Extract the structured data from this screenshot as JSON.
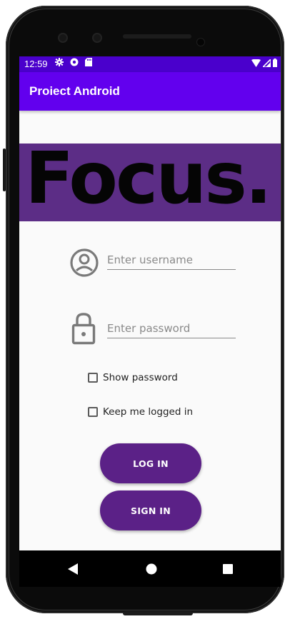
{
  "status_bar": {
    "time": "12:59",
    "left_icons": [
      "gear-icon",
      "data-saver-icon",
      "sd-card-icon"
    ],
    "right_icons": [
      "wifi-icon",
      "signal-icon",
      "battery-icon"
    ],
    "color": "#4a00cc"
  },
  "app_bar": {
    "title": "Proiect Android",
    "color": "#6200ee"
  },
  "banner": {
    "text": "Focus.",
    "background": "#5c2d86"
  },
  "form": {
    "username": {
      "icon": "account-circle-icon",
      "placeholder": "Enter username",
      "value": ""
    },
    "password": {
      "icon": "lock-icon",
      "placeholder": "Enter password",
      "value": ""
    },
    "show_password": {
      "label": "Show password",
      "checked": false
    },
    "keep_logged_in": {
      "label": "Keep me logged in",
      "checked": false
    }
  },
  "buttons": {
    "login_label": "LOG IN",
    "signin_label": "SIGN IN",
    "color": "#5b2187"
  },
  "nav_bar": {
    "items": [
      "back-icon",
      "home-icon",
      "recents-icon"
    ]
  }
}
